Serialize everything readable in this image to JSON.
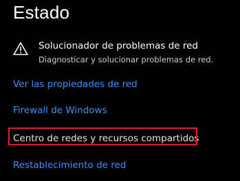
{
  "page": {
    "title": "Estado"
  },
  "troubleshooter": {
    "title": "Solucionador de problemas de red",
    "subtitle": "Diagnosticar y solucionar problemas de red.",
    "icon": "warning-triangle-icon"
  },
  "links": {
    "network_properties": "Ver las propiedades de red",
    "firewall": "Firewall de Windows",
    "network_sharing_center": "Centro de redes y recursos compartidos",
    "network_reset": "Restablecimiento de red"
  },
  "colors": {
    "background": "#000000",
    "link": "#3e8ef7",
    "highlight_border": "#e0202a"
  }
}
